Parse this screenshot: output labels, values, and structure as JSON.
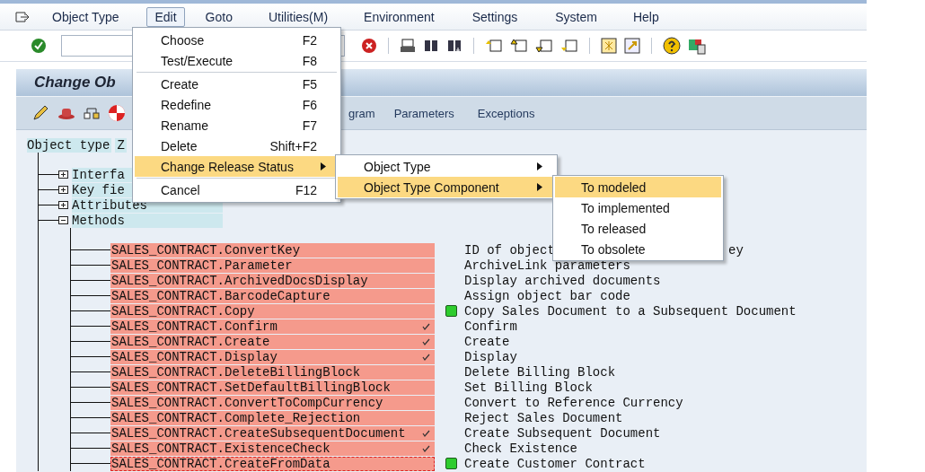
{
  "menubar": [
    {
      "label": "Object Type",
      "selected": false
    },
    {
      "label": "Edit",
      "selected": true
    },
    {
      "label": "Goto",
      "selected": false
    },
    {
      "label": "Utilities(M)",
      "selected": false
    },
    {
      "label": "Environment",
      "selected": false
    },
    {
      "label": "Settings",
      "selected": false
    },
    {
      "label": "System",
      "selected": false
    },
    {
      "label": "Help",
      "selected": false
    }
  ],
  "title": "Change Ob",
  "app_toolbar": {
    "texts": [
      "gram",
      "Parameters",
      "Exceptions"
    ]
  },
  "tree": {
    "root": {
      "label": "Object type",
      "value": "Z"
    },
    "nodes": [
      {
        "label": "Interfa",
        "expanded": false
      },
      {
        "label": "Key fie",
        "expanded": false
      },
      {
        "label": "Attributes",
        "expanded": false
      },
      {
        "label": "Methods",
        "expanded": true,
        "children": [
          {
            "name": "SALES_CONTRACT.ConvertKey",
            "checked": false,
            "status_ok": false,
            "focused": false,
            "description": "ID of object",
            "description_tail": "ey"
          },
          {
            "name": "SALES_CONTRACT.Parameter",
            "checked": false,
            "status_ok": false,
            "focused": false,
            "description": "ArchiveLink parameters"
          },
          {
            "name": "SALES_CONTRACT.ArchivedDocsDisplay",
            "checked": false,
            "status_ok": false,
            "focused": false,
            "description": "Display archived documents"
          },
          {
            "name": "SALES_CONTRACT.BarcodeCapture",
            "checked": false,
            "status_ok": false,
            "focused": false,
            "description": "Assign object bar code"
          },
          {
            "name": "SALES_CONTRACT.Copy",
            "checked": false,
            "status_ok": true,
            "focused": false,
            "description": "Copy Sales Document to a Subsequent Document"
          },
          {
            "name": "SALES_CONTRACT.Confirm",
            "checked": true,
            "status_ok": false,
            "focused": false,
            "description": "Confirm"
          },
          {
            "name": "SALES_CONTRACT.Create",
            "checked": true,
            "status_ok": false,
            "focused": false,
            "description": "Create"
          },
          {
            "name": "SALES_CONTRACT.Display",
            "checked": true,
            "status_ok": false,
            "focused": false,
            "description": "Display"
          },
          {
            "name": "SALES_CONTRACT.DeleteBillingBlock",
            "checked": false,
            "status_ok": false,
            "focused": false,
            "description": "Delete Billing Block"
          },
          {
            "name": "SALES_CONTRACT.SetDefaultBillingBlock",
            "checked": false,
            "status_ok": false,
            "focused": false,
            "description": "Set Billing Block"
          },
          {
            "name": "SALES_CONTRACT.ConvertToCompCurrency",
            "checked": false,
            "status_ok": false,
            "focused": false,
            "description": "Convert to Reference Currency"
          },
          {
            "name": "SALES_CONTRACT.Complete_Rejection",
            "checked": false,
            "status_ok": false,
            "focused": false,
            "description": "Reject Sales Document"
          },
          {
            "name": "SALES_CONTRACT.CreateSubsequentDocument",
            "checked": true,
            "status_ok": false,
            "focused": false,
            "description": "Create Subsequent Document"
          },
          {
            "name": "SALES_CONTRACT.ExistenceCheck",
            "checked": true,
            "status_ok": false,
            "focused": false,
            "description": "Check Existence"
          },
          {
            "name": "SALES_CONTRACT.CreateFromData",
            "checked": false,
            "status_ok": true,
            "focused": true,
            "description": "Create Customer Contract"
          }
        ]
      }
    ]
  },
  "edit_menu": {
    "items": [
      {
        "kind": "item",
        "label": "Choose",
        "shortcut": "F2",
        "selected": false
      },
      {
        "kind": "item",
        "label": "Test/Execute",
        "shortcut": "F8",
        "selected": false
      },
      {
        "kind": "separator"
      },
      {
        "kind": "item",
        "label": "Create",
        "shortcut": "F5",
        "selected": false
      },
      {
        "kind": "item",
        "label": "Redefine",
        "shortcut": "F6",
        "selected": false
      },
      {
        "kind": "item",
        "label": "Rename",
        "shortcut": "F7",
        "selected": false
      },
      {
        "kind": "item",
        "label": "Delete",
        "shortcut": "Shift+F2",
        "selected": false
      },
      {
        "kind": "submenu",
        "label": "Change Release Status",
        "selected": true
      },
      {
        "kind": "separator"
      },
      {
        "kind": "item",
        "label": "Cancel",
        "shortcut": "F12",
        "selected": false
      }
    ]
  },
  "release_submenu": {
    "items": [
      {
        "kind": "submenu",
        "label": "Object Type",
        "selected": false
      },
      {
        "kind": "submenu",
        "label": "Object Type Component",
        "selected": true
      }
    ]
  },
  "component_submenu": {
    "items": [
      {
        "kind": "item",
        "label": "To modeled",
        "selected": true
      },
      {
        "kind": "item",
        "label": "To implemented",
        "selected": false
      },
      {
        "kind": "item",
        "label": "To released",
        "selected": false
      },
      {
        "kind": "item",
        "label": "To obsolete",
        "selected": false
      }
    ]
  }
}
